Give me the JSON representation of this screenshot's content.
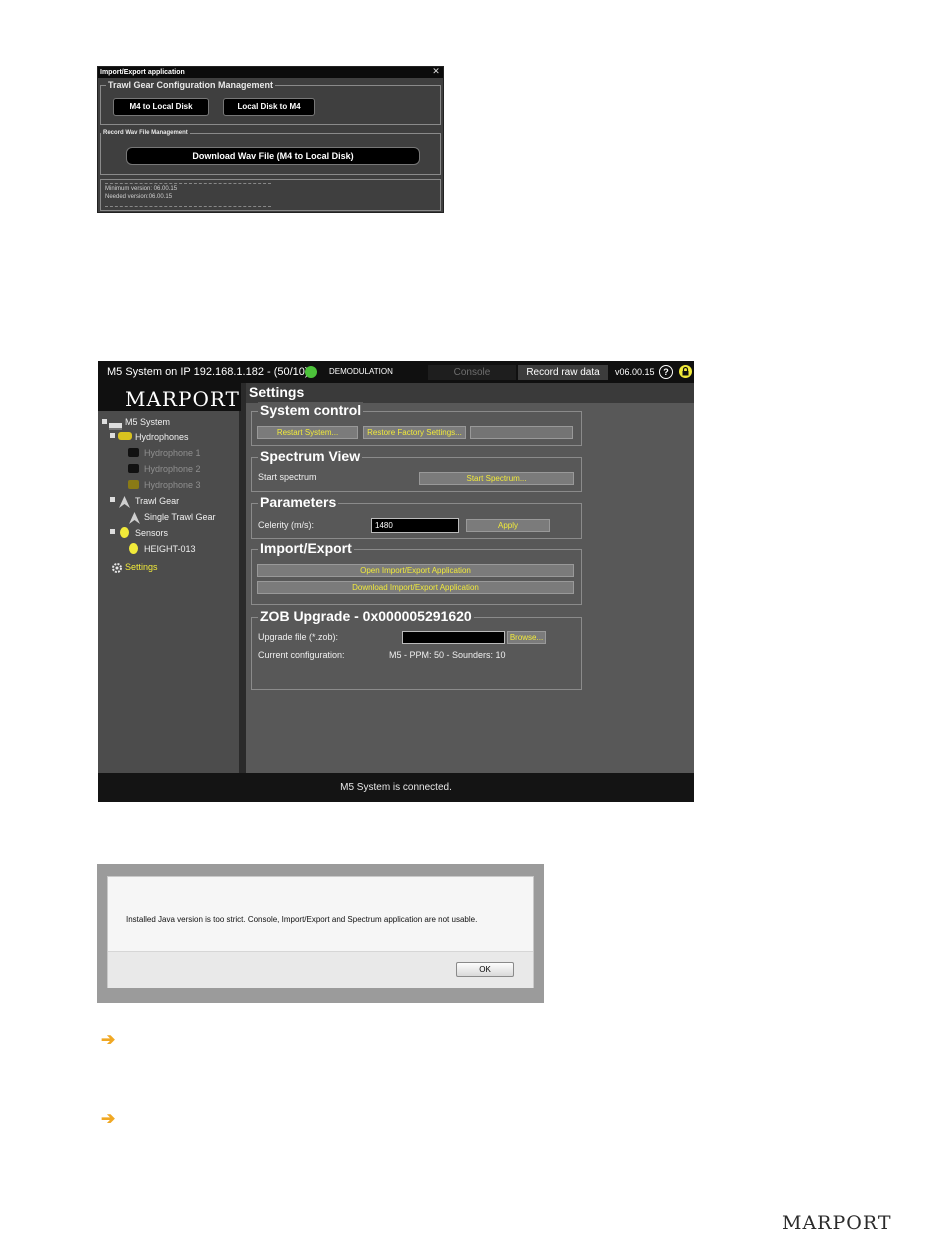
{
  "import_export": {
    "title": "Import/Export application",
    "close": "✕",
    "trawl_group_title": "Trawl Gear Configuration Management",
    "m4_to_local": "M4 to Local Disk",
    "local_to_m4": "Local Disk to M4",
    "wav_group_title": "Record Wav File Management",
    "download_wav": "Download Wav File (M4 to Local Disk)",
    "min_version": "Minimum version: 06.00.15",
    "needed_version": "Needed version:06.00.15"
  },
  "app": {
    "topbar": {
      "system_title": "M5 System on IP 192.168.1.182 - (50/10)",
      "status_color": "#4cc23a",
      "mode": "DEMODULATION",
      "console_tab": "Console",
      "record_tab": "Record raw data",
      "version": "v06.00.15",
      "help": "?"
    },
    "logo": "MARPORT",
    "tree": {
      "root": "M5 System",
      "hydrophones": "Hydrophones",
      "hydrophone1": "Hydrophone 1",
      "hydrophone2": "Hydrophone 2",
      "hydrophone3": "Hydrophone 3",
      "trawl_gear": "Trawl Gear",
      "single_trawl": "Single Trawl Gear",
      "sensors": "Sensors",
      "height": "HEIGHT-013",
      "settings": "Settings"
    },
    "content_title": "Settings",
    "system_control": {
      "title": "System control",
      "restart": "Restart System...",
      "restore": "Restore Factory Settings..."
    },
    "spectrum": {
      "title": "Spectrum View",
      "label": "Start spectrum",
      "button": "Start Spectrum..."
    },
    "parameters": {
      "title": "Parameters",
      "label": "Celerity (m/s):",
      "value": "1480",
      "apply": "Apply"
    },
    "import_export": {
      "title": "Import/Export",
      "open": "Open Import/Export Application",
      "download": "Download Import/Export Application"
    },
    "zob": {
      "title": "ZOB Upgrade - 0x000005291620",
      "file_label": "Upgrade file (*.zob):",
      "browse": "Browse...",
      "config_label": "Current configuration:",
      "config_value": "M5 - PPM: 50 - Sounders: 10"
    },
    "status": "M5 System is connected."
  },
  "dialog": {
    "message": "Installed Java version is too strict. Console, Import/Export and Spectrum application are not usable.",
    "ok": "OK"
  },
  "footer_logo": "MARPORT",
  "accent": "#f0a824"
}
